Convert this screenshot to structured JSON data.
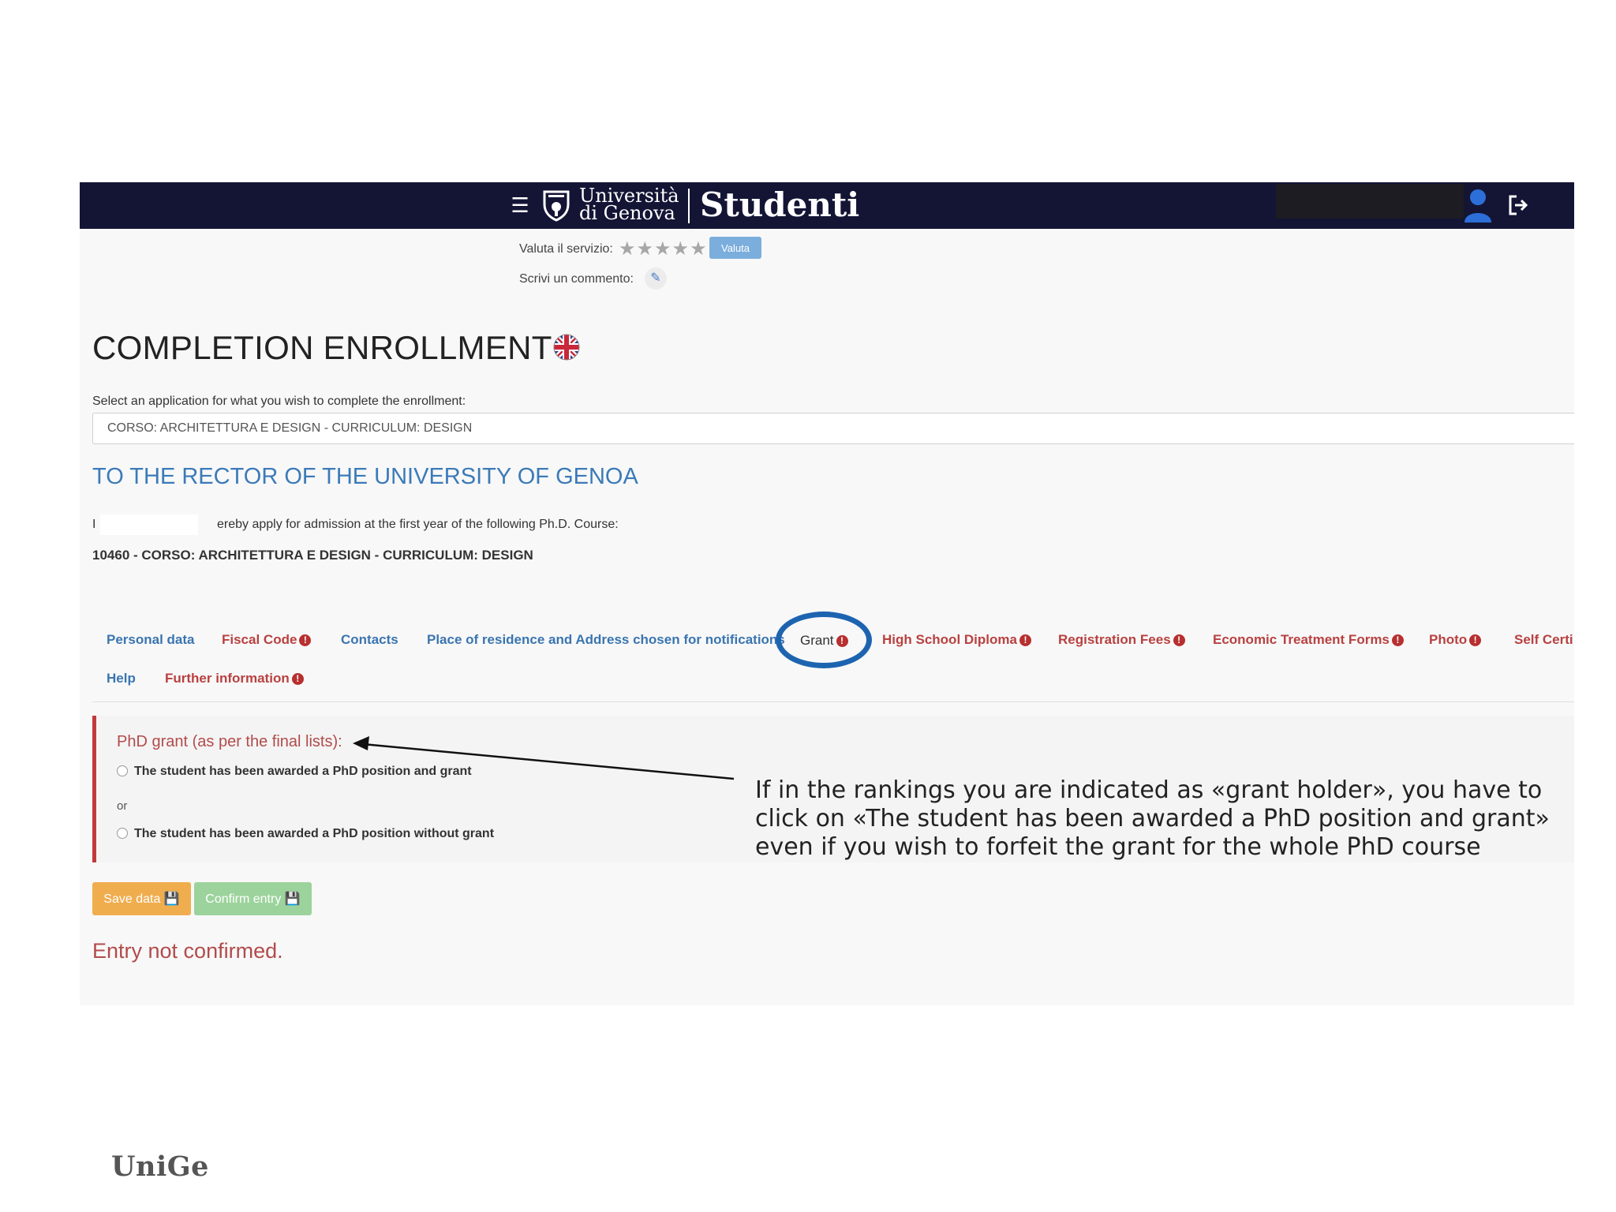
{
  "header": {
    "menu_icon": "hamburger-icon",
    "university_line1": "Università",
    "university_line2": "di Genova",
    "app_name": "Studenti",
    "colors": {
      "bar": "#141535",
      "text": "#ffffff"
    }
  },
  "rating": {
    "label": "Valuta il servizio:",
    "stars": "★★★★★",
    "button": "Valuta",
    "comment_label": "Scrivi un commento:"
  },
  "page": {
    "title": "COMPLETION ENROLLMENT",
    "select_label": "Select an application for what you wish to complete the enrollment:",
    "select_value": "CORSO: ARCHITETTURA E DESIGN - CURRICULUM: DESIGN",
    "heading": "TO THE RECTOR OF THE UNIVERSITY OF GENOA",
    "apply_prefix": "I",
    "apply_text": "ereby apply for admission at the first year of the following Ph.D. Course:",
    "course": "10460 - CORSO: ARCHITETTURA E DESIGN - CURRICULUM: DESIGN"
  },
  "tabs": [
    {
      "label": "Personal data",
      "state": "ok"
    },
    {
      "label": "Fiscal Code",
      "state": "warning"
    },
    {
      "label": "Contacts",
      "state": "ok"
    },
    {
      "label": "Place of residence and Address chosen for notifications",
      "state": "ok"
    },
    {
      "label": "Grant",
      "state": "active-warning"
    },
    {
      "label": "High School Diploma",
      "state": "warning"
    },
    {
      "label": "Registration Fees",
      "state": "warning"
    },
    {
      "label": "Economic Treatment Forms",
      "state": "warning"
    },
    {
      "label": "Photo",
      "state": "warning"
    },
    {
      "label": "Self Certi",
      "state": "warning"
    },
    {
      "label": "Help",
      "state": "ok"
    },
    {
      "label": "Further information",
      "state": "warning"
    }
  ],
  "grant_panel": {
    "title": "PhD grant (as per the final lists):",
    "option1": "The student has been awarded a PhD position and grant",
    "or": "or",
    "option2": "The student has been awarded a PhD position without grant"
  },
  "buttons": {
    "save": "Save data",
    "confirm": "Confirm entry"
  },
  "status": "Entry not confirmed.",
  "annotation": "If in the rankings you are indicated as «grant holder», you have to click on «The student has been awarded a PhD position and grant» even if you wish to forfeit the grant for the whole PhD course",
  "footer_logo": "UniGe"
}
